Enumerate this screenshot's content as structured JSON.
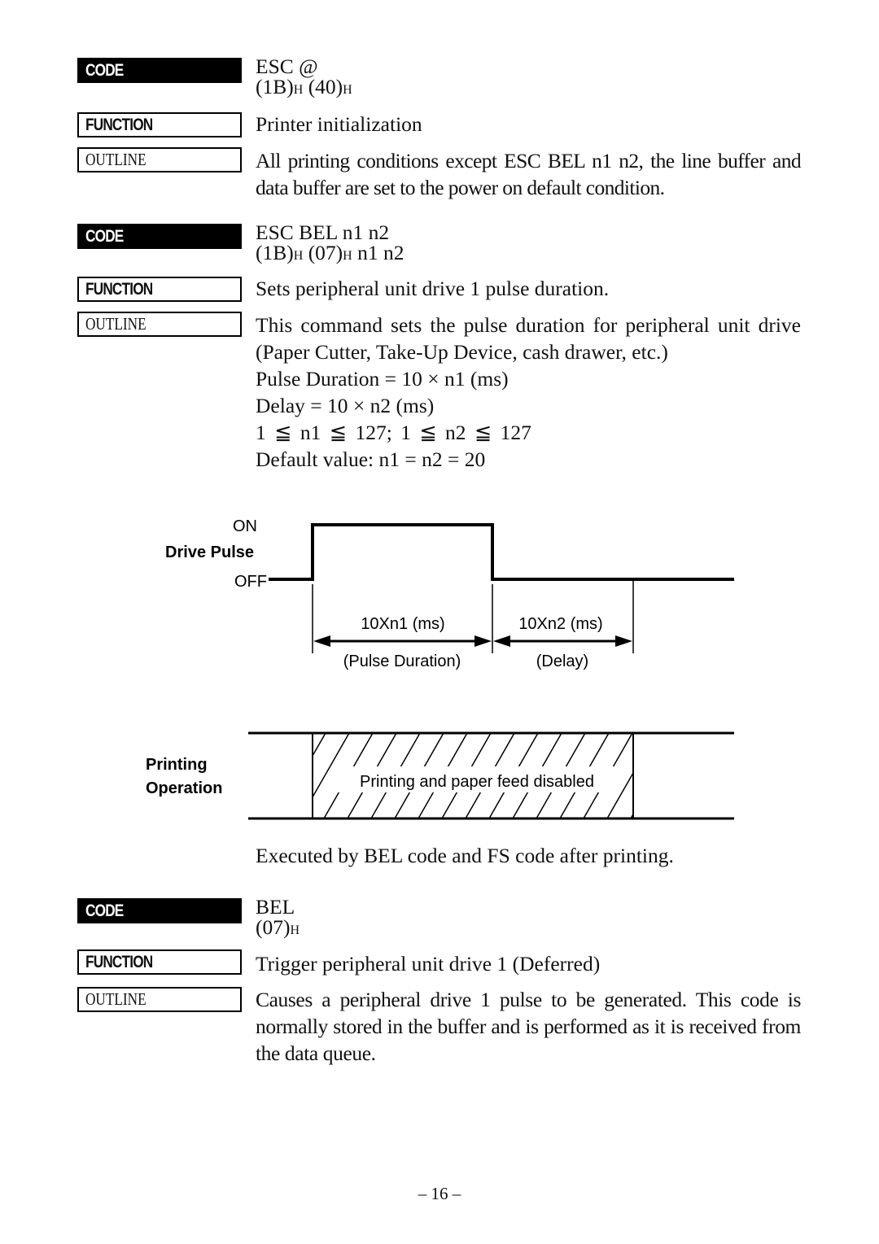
{
  "labels": {
    "code": "CODE",
    "function": "FUNCTION",
    "outline": "OUTLINE"
  },
  "commands": [
    {
      "code_line1": "ESC @",
      "code_hex": [
        "(1B)",
        "H",
        " (40)",
        "H"
      ],
      "function": "Printer initialization",
      "outline": "All printing conditions except ESC BEL n1 n2, the line buffer and data buffer are set to the power on default condition."
    },
    {
      "code_line1": "ESC BEL n1 n2",
      "code_hex": [
        "(1B)",
        "H",
        " (07)",
        "H",
        " n1 n2"
      ],
      "function": "Sets peripheral unit drive 1 pulse duration.",
      "outline_lines": [
        "This command sets the pulse duration for peripheral unit drive (Paper Cutter, Take-Up Device, cash drawer, etc.)",
        "Pulse Duration = 10 × n1 (ms)",
        "Delay = 10 × n2 (ms)",
        "1 ≦ n1 ≦ 127; 1 ≦ n2 ≦ 127",
        "Default value: n1 = n2 = 20"
      ],
      "diagram": {
        "drive_pulse": {
          "label": "Drive Pulse",
          "on_label": "ON",
          "off_label": "OFF",
          "pulse_formula": "10Xn1 (ms)",
          "pulse_caption": "(Pulse Duration)",
          "delay_formula": "10Xn2 (ms)",
          "delay_caption": "(Delay)"
        },
        "printing_operation": {
          "label_line1": "Printing",
          "label_line2": "Operation",
          "disabled_text": "Printing and paper feed disabled"
        }
      },
      "note": "Executed by BEL code and FS code after printing."
    },
    {
      "code_line1": "BEL",
      "code_hex": [
        "(07)",
        "H"
      ],
      "function": "Trigger peripheral unit drive 1 (Deferred)",
      "outline": "Causes a peripheral drive 1 pulse to be generated. This code is normally stored in the buffer and is performed as it is received from the data queue."
    }
  ],
  "page_number": "– 16 –"
}
